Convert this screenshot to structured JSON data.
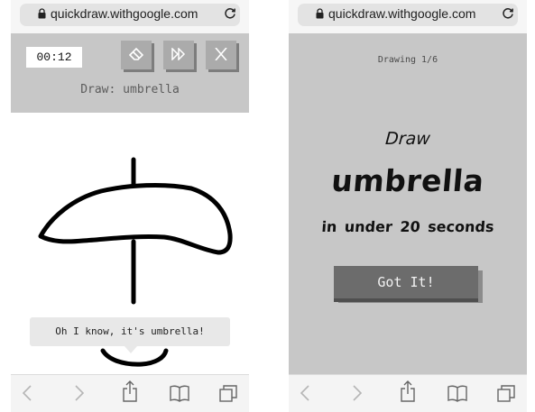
{
  "left": {
    "url": "quickdraw.withgoogle.com",
    "timer": "00:12",
    "prompt": "Draw: umbrella",
    "tools": [
      "eraser-icon",
      "skip-icon",
      "close-icon"
    ],
    "guess_bubble": "Oh I know, it's umbrella!",
    "toolbar_icons": [
      "back-icon",
      "forward-icon",
      "share-icon",
      "bookmarks-icon",
      "tabs-icon"
    ]
  },
  "right": {
    "url": "quickdraw.withgoogle.com",
    "drawing_count": "Drawing 1/6",
    "draw_label": "Draw",
    "target_word": "umbrella",
    "time_limit": "in under 20 seconds",
    "got_it_button": "Got It!",
    "toolbar_icons": [
      "back-icon",
      "forward-icon",
      "share-icon",
      "bookmarks-icon",
      "tabs-icon"
    ]
  },
  "colors": {
    "header_gray": "#c7c7c7",
    "button_gray": "#6c6c6c",
    "tool_button_gray": "#ababab"
  }
}
